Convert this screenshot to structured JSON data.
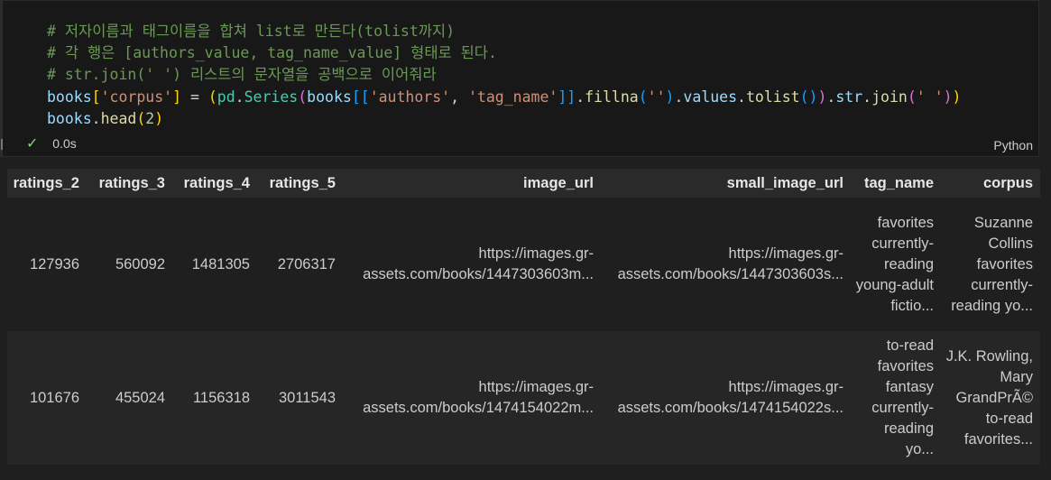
{
  "cell": {
    "code_lines": [
      [
        {
          "t": "# 저자이름과 태그이름을 합쳐 list로 만든다(tolist까지)",
          "c": "#6a9955"
        }
      ],
      [
        {
          "t": "# 각 행은 [authors_value, tag_name_value] 형태로 된다.",
          "c": "#6a9955"
        }
      ],
      [
        {
          "t": "# str.join(' ') 리스트의 문자열을 공백으로 이어줘라",
          "c": "#6a9955"
        }
      ],
      [
        {
          "t": "books",
          "c": "#9cdcfe"
        },
        {
          "t": "[",
          "c": "#ffd700"
        },
        {
          "t": "'corpus'",
          "c": "#ce9178"
        },
        {
          "t": "]",
          "c": "#ffd700"
        },
        {
          "t": " = ",
          "c": "#d4d4d4"
        },
        {
          "t": "(",
          "c": "#ffd700"
        },
        {
          "t": "pd",
          "c": "#4ec9b0"
        },
        {
          "t": ".",
          "c": "#d4d4d4"
        },
        {
          "t": "Series",
          "c": "#4ec9b0"
        },
        {
          "t": "(",
          "c": "#da70d6"
        },
        {
          "t": "books",
          "c": "#9cdcfe"
        },
        {
          "t": "[[",
          "c": "#179fff"
        },
        {
          "t": "'authors'",
          "c": "#ce9178"
        },
        {
          "t": ", ",
          "c": "#d4d4d4"
        },
        {
          "t": "'tag_name'",
          "c": "#ce9178"
        },
        {
          "t": "]]",
          "c": "#179fff"
        },
        {
          "t": ".",
          "c": "#d4d4d4"
        },
        {
          "t": "fillna",
          "c": "#dcdcaa"
        },
        {
          "t": "(",
          "c": "#179fff"
        },
        {
          "t": "''",
          "c": "#ce9178"
        },
        {
          "t": ")",
          "c": "#179fff"
        },
        {
          "t": ".",
          "c": "#d4d4d4"
        },
        {
          "t": "values",
          "c": "#9cdcfe"
        },
        {
          "t": ".",
          "c": "#d4d4d4"
        },
        {
          "t": "tolist",
          "c": "#dcdcaa"
        },
        {
          "t": "()",
          "c": "#179fff"
        },
        {
          "t": ")",
          "c": "#da70d6"
        },
        {
          "t": ".",
          "c": "#d4d4d4"
        },
        {
          "t": "str",
          "c": "#9cdcfe"
        },
        {
          "t": ".",
          "c": "#d4d4d4"
        },
        {
          "t": "join",
          "c": "#dcdcaa"
        },
        {
          "t": "(",
          "c": "#da70d6"
        },
        {
          "t": "' '",
          "c": "#ce9178"
        },
        {
          "t": ")",
          "c": "#da70d6"
        },
        {
          "t": ")",
          "c": "#ffd700"
        }
      ],
      [
        {
          "t": "books",
          "c": "#9cdcfe"
        },
        {
          "t": ".",
          "c": "#d4d4d4"
        },
        {
          "t": "head",
          "c": "#dcdcaa"
        },
        {
          "t": "(",
          "c": "#ffd700"
        },
        {
          "t": "2",
          "c": "#b5cea8"
        },
        {
          "t": ")",
          "c": "#ffd700"
        }
      ]
    ],
    "exec_time": "0.0s",
    "language": "Python",
    "check_icon": "check-icon"
  },
  "table": {
    "columns": [
      "ratings_2",
      "ratings_3",
      "ratings_4",
      "ratings_5",
      "image_url",
      "small_image_url",
      "tag_name",
      "corpus"
    ],
    "rows": [
      [
        "127936",
        "560092",
        "1481305",
        "2706317",
        "https://images.gr-assets.com/books/1447303603m...",
        "https://images.gr-assets.com/books/1447303603s...",
        "favorites currently-reading young-adult fictio...",
        "Suzanne Collins favorites currently-reading yo..."
      ],
      [
        "101676",
        "455024",
        "1156318",
        "3011543",
        "https://images.gr-assets.com/books/1474154022m...",
        "https://images.gr-assets.com/books/1474154022s...",
        "to-read favorites fantasy currently-reading yo...",
        "J.K. Rowling, Mary GrandPrÃ© to-read favorites..."
      ]
    ]
  },
  "colors": {
    "background": "#1f1f1f",
    "cell_bg": "#181818",
    "header_bg": "#2a2a2a",
    "check": "#89d185"
  }
}
